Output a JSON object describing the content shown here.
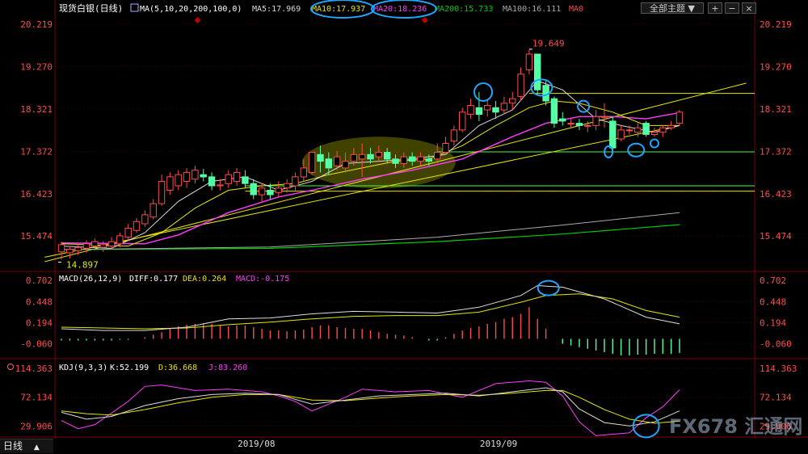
{
  "header": {
    "instrument": "现货白银(日线)",
    "ma_spec": "MA(5,10,20,200,100,0)",
    "ma5": "MA5:17.969",
    "ma10": "MA10:17.937",
    "ma20": "MA20:18.236",
    "ma200": "MA200:15.733",
    "ma100": "MA100:16.111",
    "ma0": "MA0",
    "topic_select": "全部主题"
  },
  "colors": {
    "up": "#ff4c4c",
    "down": "#54ffa6",
    "ma5": "#d8d8d8",
    "ma10": "#e6e600",
    "ma20": "#ff3cff",
    "ma200": "#00cc00",
    "ma100": "#aaaaaa",
    "axis_label": "#ff4c4c",
    "grid": "#2e0000",
    "annotation": "#1fa6ff"
  },
  "price_axis": [
    "20.219",
    "19.270",
    "18.321",
    "17.372",
    "16.423",
    "15.474"
  ],
  "macd_header": {
    "spec": "MACD(26,12,9)",
    "diff": "DIFF:0.177",
    "dea": "DEA:0.264",
    "macd": "MACD:-0.175"
  },
  "macd_axis": [
    "0.702",
    "0.448",
    "0.194",
    "-0.060"
  ],
  "kdj_header": {
    "spec": "KDJ(9,3,3)",
    "k": "K:52.199",
    "d": "D:36.668",
    "j": "J:83.260"
  },
  "kdj_axis": [
    "114.363",
    "72.134",
    "29.906"
  ],
  "date_labels": [
    "2019/08",
    "2019/09"
  ],
  "period_tab": "日线",
  "watermark": "FX678 汇通网",
  "chart_data": {
    "type": "candlestick",
    "ylim": [
      14.7,
      20.4
    ],
    "annotations": {
      "high": "19.649",
      "low": "14.897"
    },
    "candles": [
      [
        15.12,
        15.28,
        14.95,
        15.35
      ],
      [
        15.1,
        15.18,
        14.97,
        15.25
      ],
      [
        15.15,
        15.22,
        15.05,
        15.3
      ],
      [
        15.2,
        15.3,
        15.1,
        15.38
      ],
      [
        15.25,
        15.35,
        15.15,
        15.42
      ],
      [
        15.22,
        15.28,
        15.12,
        15.36
      ],
      [
        15.25,
        15.35,
        15.18,
        15.45
      ],
      [
        15.3,
        15.48,
        15.22,
        15.55
      ],
      [
        15.45,
        15.65,
        15.38,
        15.75
      ],
      [
        15.6,
        15.8,
        15.55,
        15.88
      ],
      [
        15.75,
        15.95,
        15.68,
        16.05
      ],
      [
        15.9,
        16.2,
        15.85,
        16.3
      ],
      [
        16.2,
        16.7,
        16.15,
        16.85
      ],
      [
        16.5,
        16.8,
        16.4,
        16.9
      ],
      [
        16.6,
        16.85,
        16.5,
        16.95
      ],
      [
        16.7,
        16.9,
        16.55,
        17.0
      ],
      [
        16.75,
        16.95,
        16.65,
        17.05
      ],
      [
        16.85,
        16.8,
        16.7,
        16.98
      ],
      [
        16.8,
        16.6,
        16.5,
        16.9
      ],
      [
        16.6,
        16.62,
        16.5,
        16.75
      ],
      [
        16.65,
        16.85,
        16.55,
        16.95
      ],
      [
        16.7,
        16.9,
        16.6,
        17.0
      ],
      [
        16.8,
        16.65,
        16.55,
        16.95
      ],
      [
        16.65,
        16.4,
        16.3,
        16.75
      ],
      [
        16.4,
        16.55,
        16.25,
        16.65
      ],
      [
        16.5,
        16.4,
        16.3,
        16.65
      ],
      [
        16.45,
        16.55,
        16.35,
        16.7
      ],
      [
        16.55,
        16.65,
        16.45,
        16.75
      ],
      [
        16.6,
        16.8,
        16.5,
        16.9
      ],
      [
        16.8,
        17.0,
        16.7,
        17.2
      ],
      [
        16.9,
        17.35,
        16.85,
        17.35
      ],
      [
        17.3,
        17.15,
        16.9,
        17.5
      ],
      [
        17.2,
        17.0,
        16.85,
        17.35
      ],
      [
        17.05,
        17.25,
        16.95,
        17.38
      ],
      [
        17.0,
        17.15,
        16.9,
        17.35
      ],
      [
        17.15,
        17.3,
        17.05,
        17.45
      ],
      [
        17.2,
        17.3,
        16.8,
        17.55
      ],
      [
        17.3,
        17.2,
        17.1,
        17.45
      ],
      [
        17.25,
        17.35,
        17.15,
        17.5
      ],
      [
        17.35,
        17.2,
        17.1,
        17.45
      ],
      [
        17.2,
        17.1,
        17.0,
        17.3
      ],
      [
        17.1,
        17.25,
        17.0,
        17.35
      ],
      [
        17.25,
        17.15,
        17.05,
        17.35
      ],
      [
        17.15,
        17.25,
        17.05,
        17.35
      ],
      [
        17.2,
        17.15,
        17.05,
        17.3
      ],
      [
        17.2,
        17.35,
        17.1,
        17.55
      ],
      [
        17.35,
        17.55,
        17.3,
        17.7
      ],
      [
        17.6,
        17.85,
        17.5,
        17.95
      ],
      [
        17.85,
        18.25,
        17.8,
        18.35
      ],
      [
        18.2,
        18.4,
        18.1,
        18.55
      ],
      [
        18.35,
        18.2,
        18.05,
        18.7
      ],
      [
        18.3,
        18.4,
        18.15,
        18.55
      ],
      [
        18.35,
        18.25,
        18.1,
        18.5
      ],
      [
        18.3,
        18.45,
        18.2,
        18.6
      ],
      [
        18.45,
        18.55,
        18.3,
        18.7
      ],
      [
        18.6,
        19.1,
        18.5,
        19.25
      ],
      [
        19.2,
        19.55,
        19.1,
        19.65
      ],
      [
        19.55,
        18.75,
        18.65,
        19.55
      ],
      [
        18.85,
        18.5,
        18.4,
        18.95
      ],
      [
        18.55,
        18.0,
        17.9,
        18.6
      ],
      [
        18.1,
        18.05,
        17.95,
        18.25
      ],
      [
        18.0,
        18.0,
        17.9,
        18.1
      ],
      [
        18.0,
        17.95,
        17.85,
        18.1
      ],
      [
        17.95,
        17.95,
        17.8,
        18.05
      ],
      [
        17.95,
        18.15,
        17.85,
        18.3
      ],
      [
        18.15,
        18.15,
        17.9,
        18.45
      ],
      [
        18.05,
        17.45,
        17.4,
        18.15
      ],
      [
        17.65,
        17.85,
        17.6,
        17.95
      ],
      [
        17.85,
        17.85,
        17.75,
        17.95
      ],
      [
        17.8,
        17.9,
        17.7,
        18.0
      ],
      [
        18.0,
        17.75,
        17.7,
        18.05
      ],
      [
        17.75,
        17.8,
        17.7,
        17.9
      ],
      [
        17.8,
        17.9,
        17.7,
        17.95
      ],
      [
        17.9,
        17.95,
        17.85,
        18.05
      ],
      [
        18.0,
        18.25,
        17.95,
        18.3
      ]
    ],
    "lines": {
      "ma5": [
        [
          0,
          15.25
        ],
        [
          6,
          15.2
        ],
        [
          10,
          15.55
        ],
        [
          14,
          16.25
        ],
        [
          18,
          16.7
        ],
        [
          22,
          16.8
        ],
        [
          26,
          16.5
        ],
        [
          30,
          16.7
        ],
        [
          34,
          17.1
        ],
        [
          38,
          17.15
        ],
        [
          42,
          17.2
        ],
        [
          46,
          17.3
        ],
        [
          50,
          17.95
        ],
        [
          54,
          18.3
        ],
        [
          57,
          18.95
        ],
        [
          60,
          18.75
        ],
        [
          64,
          18.1
        ],
        [
          67,
          17.95
        ],
        [
          71,
          17.8
        ],
        [
          74,
          17.95
        ]
      ],
      "ma10": [
        [
          0,
          15.3
        ],
        [
          8,
          15.25
        ],
        [
          12,
          15.55
        ],
        [
          16,
          16.1
        ],
        [
          20,
          16.5
        ],
        [
          24,
          16.6
        ],
        [
          28,
          16.65
        ],
        [
          32,
          16.85
        ],
        [
          36,
          17.0
        ],
        [
          40,
          17.15
        ],
        [
          44,
          17.2
        ],
        [
          48,
          17.5
        ],
        [
          52,
          17.95
        ],
        [
          56,
          18.35
        ],
        [
          59,
          18.5
        ],
        [
          62,
          18.45
        ],
        [
          66,
          18.25
        ],
        [
          70,
          17.95
        ],
        [
          74,
          17.95
        ]
      ],
      "ma20": [
        [
          0,
          15.32
        ],
        [
          10,
          15.3
        ],
        [
          14,
          15.5
        ],
        [
          20,
          16.0
        ],
        [
          26,
          16.35
        ],
        [
          30,
          16.5
        ],
        [
          36,
          16.75
        ],
        [
          42,
          16.95
        ],
        [
          48,
          17.2
        ],
        [
          54,
          17.7
        ],
        [
          58,
          18.0
        ],
        [
          62,
          18.15
        ],
        [
          66,
          18.15
        ],
        [
          70,
          18.1
        ],
        [
          74,
          18.24
        ]
      ],
      "ma100": [
        [
          0,
          15.17
        ],
        [
          25,
          15.23
        ],
        [
          45,
          15.45
        ],
        [
          60,
          15.72
        ],
        [
          74,
          16.0
        ]
      ],
      "ma200": [
        [
          0,
          15.17
        ],
        [
          25,
          15.2
        ],
        [
          45,
          15.35
        ],
        [
          60,
          15.52
        ],
        [
          74,
          15.73
        ]
      ],
      "trend_a": [
        [
          -2,
          14.9
        ],
        [
          82,
          18.9
        ]
      ],
      "trend_b": [
        [
          -2,
          15.0
        ],
        [
          74,
          17.95
        ]
      ]
    },
    "levels": {
      "yellow_upper": 18.67,
      "green": 17.36,
      "green_low": 16.6,
      "yellow_low": 16.48
    },
    "macd": {
      "ylim": [
        -0.2,
        0.8
      ],
      "hist": [
        -0.02,
        -0.02,
        -0.02,
        -0.02,
        -0.02,
        -0.02,
        -0.02,
        -0.01,
        -0.01,
        0.0,
        0.02,
        0.05,
        0.08,
        0.12,
        0.15,
        0.17,
        0.18,
        0.19,
        0.18,
        0.16,
        0.15,
        0.16,
        0.16,
        0.14,
        0.12,
        0.1,
        0.1,
        0.09,
        0.1,
        0.11,
        0.14,
        0.16,
        0.16,
        0.14,
        0.13,
        0.12,
        0.12,
        0.1,
        0.08,
        0.06,
        0.05,
        0.04,
        0.02,
        0.0,
        -0.02,
        -0.02,
        0.02,
        0.06,
        0.1,
        0.13,
        0.15,
        0.18,
        0.2,
        0.24,
        0.26,
        0.3,
        0.38,
        0.24,
        0.12,
        0.0,
        -0.06,
        -0.08,
        -0.1,
        -0.12,
        -0.14,
        -0.16,
        -0.18,
        -0.2,
        -0.2,
        -0.19,
        -0.19,
        -0.18,
        -0.18,
        -0.18,
        -0.17
      ],
      "diff": [
        [
          0,
          0.12
        ],
        [
          5,
          0.1
        ],
        [
          10,
          0.1
        ],
        [
          15,
          0.14
        ],
        [
          20,
          0.24
        ],
        [
          25,
          0.25
        ],
        [
          30,
          0.3
        ],
        [
          35,
          0.33
        ],
        [
          40,
          0.32
        ],
        [
          45,
          0.31
        ],
        [
          50,
          0.38
        ],
        [
          55,
          0.52
        ],
        [
          57,
          0.64
        ],
        [
          60,
          0.62
        ],
        [
          65,
          0.48
        ],
        [
          70,
          0.26
        ],
        [
          74,
          0.18
        ]
      ],
      "dea": [
        [
          0,
          0.14
        ],
        [
          10,
          0.12
        ],
        [
          15,
          0.13
        ],
        [
          20,
          0.17
        ],
        [
          25,
          0.2
        ],
        [
          30,
          0.24
        ],
        [
          35,
          0.27
        ],
        [
          40,
          0.28
        ],
        [
          45,
          0.28
        ],
        [
          50,
          0.32
        ],
        [
          55,
          0.44
        ],
        [
          58,
          0.52
        ],
        [
          62,
          0.54
        ],
        [
          66,
          0.48
        ],
        [
          70,
          0.34
        ],
        [
          74,
          0.26
        ]
      ]
    },
    "kdj": {
      "ylim": [
        15,
        125
      ],
      "k": [
        [
          0,
          50
        ],
        [
          3,
          40
        ],
        [
          6,
          44
        ],
        [
          10,
          60
        ],
        [
          14,
          70
        ],
        [
          18,
          76
        ],
        [
          22,
          78
        ],
        [
          26,
          76
        ],
        [
          30,
          62
        ],
        [
          34,
          68
        ],
        [
          38,
          74
        ],
        [
          42,
          76
        ],
        [
          46,
          78
        ],
        [
          50,
          74
        ],
        [
          54,
          80
        ],
        [
          58,
          86
        ],
        [
          60,
          80
        ],
        [
          62,
          55
        ],
        [
          65,
          35
        ],
        [
          68,
          30
        ],
        [
          71,
          36
        ],
        [
          74,
          52
        ]
      ],
      "d": [
        [
          0,
          52
        ],
        [
          3,
          48
        ],
        [
          6,
          46
        ],
        [
          10,
          54
        ],
        [
          14,
          64
        ],
        [
          18,
          72
        ],
        [
          22,
          76
        ],
        [
          26,
          76
        ],
        [
          30,
          68
        ],
        [
          34,
          67
        ],
        [
          38,
          71
        ],
        [
          42,
          74
        ],
        [
          46,
          76
        ],
        [
          50,
          75
        ],
        [
          54,
          78
        ],
        [
          58,
          82
        ],
        [
          60,
          82
        ],
        [
          62,
          72
        ],
        [
          65,
          54
        ],
        [
          68,
          40
        ],
        [
          71,
          34
        ],
        [
          74,
          37
        ]
      ],
      "j": [
        [
          0,
          38
        ],
        [
          2,
          26
        ],
        [
          4,
          32
        ],
        [
          8,
          66
        ],
        [
          10,
          88
        ],
        [
          12,
          90
        ],
        [
          16,
          82
        ],
        [
          20,
          84
        ],
        [
          24,
          80
        ],
        [
          26,
          74
        ],
        [
          28,
          66
        ],
        [
          30,
          52
        ],
        [
          32,
          62
        ],
        [
          34,
          72
        ],
        [
          36,
          84
        ],
        [
          40,
          80
        ],
        [
          44,
          82
        ],
        [
          48,
          72
        ],
        [
          52,
          92
        ],
        [
          56,
          96
        ],
        [
          58,
          94
        ],
        [
          60,
          74
        ],
        [
          62,
          36
        ],
        [
          64,
          16
        ],
        [
          66,
          18
        ],
        [
          68,
          20
        ],
        [
          70,
          42
        ],
        [
          72,
          58
        ],
        [
          74,
          83
        ]
      ]
    }
  }
}
